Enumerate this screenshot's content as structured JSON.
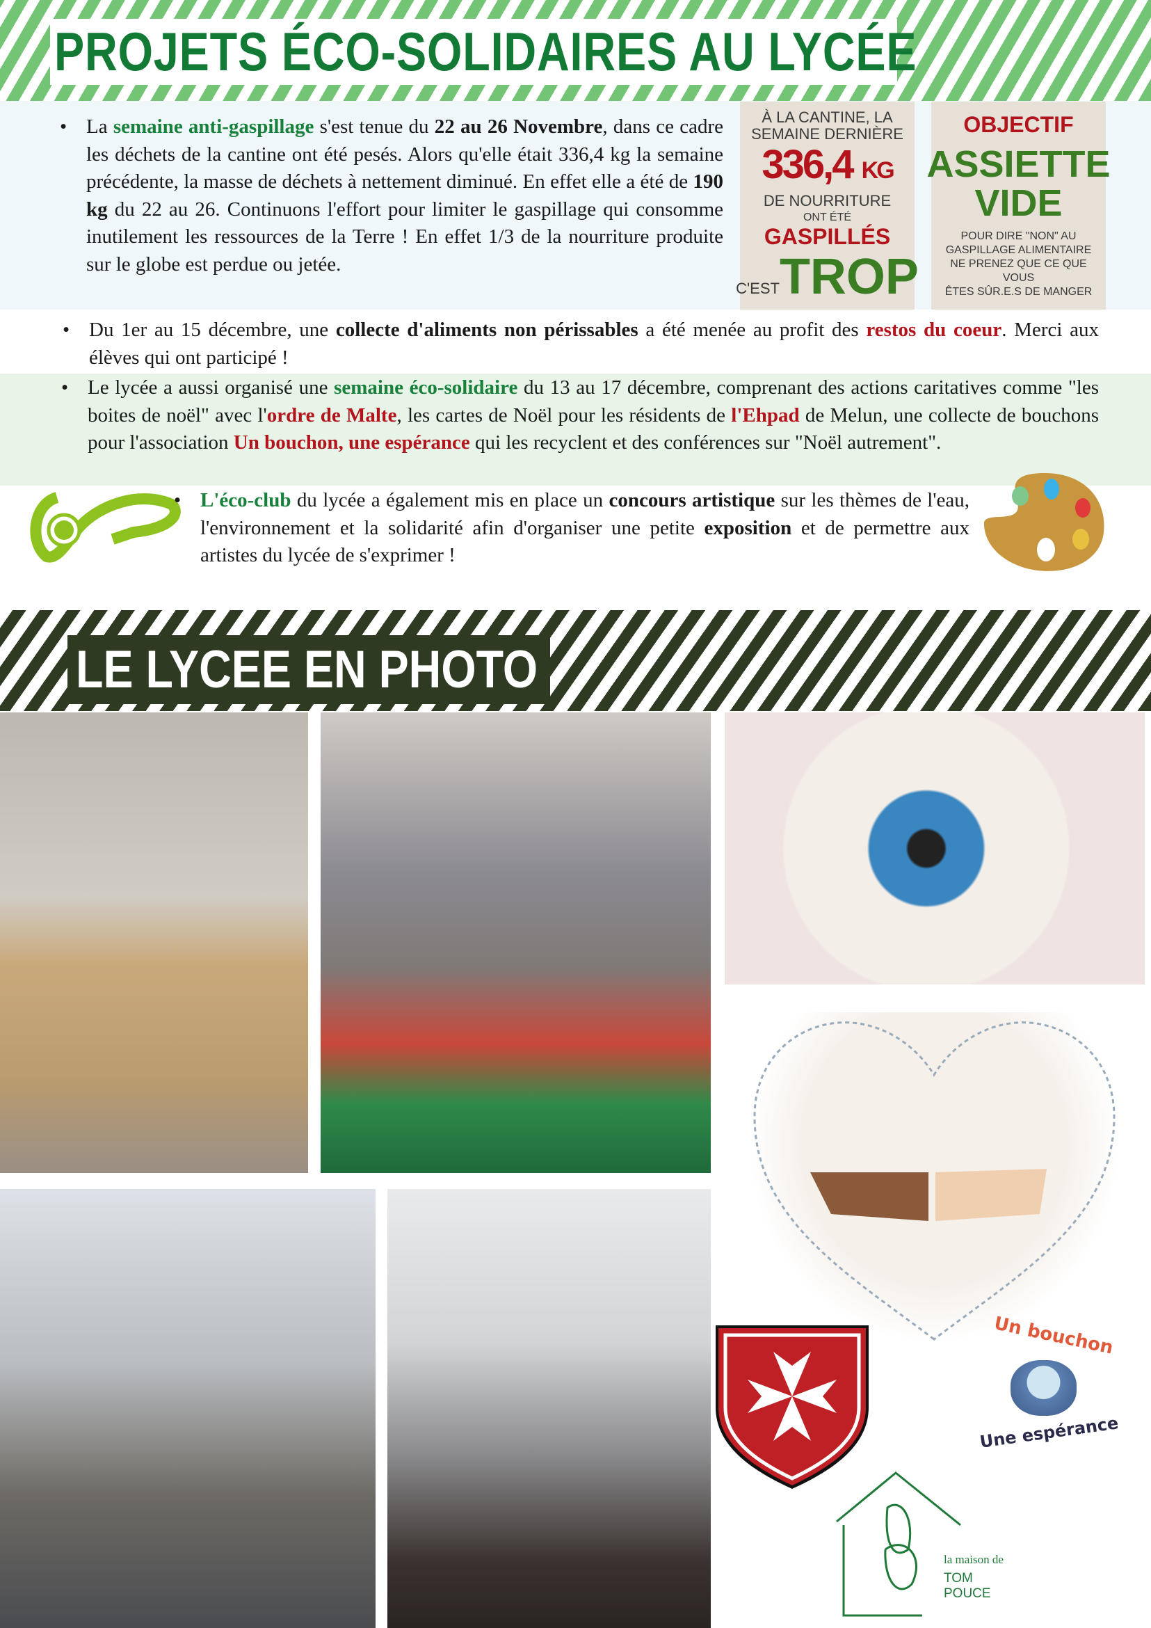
{
  "header": {
    "title": "PROJETS ÉCO-SOLIDAIRES AU LYCÉE"
  },
  "section1": {
    "p1": "La ",
    "h1": "semaine anti-gaspillage",
    "p2": " s'est tenue du ",
    "b1": "22 au 26 Novembre",
    "p3": ", dans ce cadre les déchets de la cantine ont été pesés. Alors qu'elle était 336,4 kg la semaine précédente, la masse de déchets à nettement diminué. En effet elle a été de ",
    "b2": "190 kg",
    "p4": " du 22 au 26. Continuons l'effort pour limiter le gaspillage qui consomme inutilement les ressources de la Terre ! En effet 1/3 de la nourriture produite sur le globe est perdue ou jetée."
  },
  "poster1": {
    "l1": "À LA CANTINE, LA",
    "l2": "SEMAINE DERNIÈRE",
    "big": "336,4",
    "unit": "KG",
    "l3": "DE NOURRITURE",
    "l4": "ONT ÉTÉ",
    "l5": "GASPILLÉS",
    "l6": "C'EST",
    "l7": "TROP"
  },
  "poster2": {
    "l1": "OBJECTIF",
    "l2": "ASSIETTE",
    "l3": "VIDE",
    "l4": "POUR DIRE \"NON\" AU",
    "l5": "GASPILLAGE ALIMENTAIRE",
    "l6": "NE PRENEZ QUE CE QUE VOUS",
    "l7": "ÊTES SÛR.E.S DE MANGER"
  },
  "section2": {
    "p1": "Du 1er au 15 décembre, une ",
    "b1": "collecte d'aliments non périssables",
    "p2": " a été menée au profit des ",
    "r1": "restos du coeur",
    "p3": ". Merci aux élèves qui ont participé !"
  },
  "section3": {
    "p1": "Le lycée a aussi organisé une ",
    "g1": "semaine éco-solidaire",
    "p2": " du 13 au 17 décembre, comprenant des actions caritatives comme \"les boites de noël\" avec l'",
    "r1": "ordre de Malte",
    "p3": ", les cartes de Noël pour les résidents de ",
    "r2": "l'Ehpad",
    "p4": " de Melun, une collecte de bouchons pour l'association ",
    "r3": "Un bouchon, une espérance",
    "p5": " qui les recyclent et des conférences sur \"Noël autrement\"."
  },
  "section4": {
    "g1": "L'éco-club",
    "p1": " du lycée a également mis en place un ",
    "b1": "concours artistique",
    "p2": " sur les thèmes de l'eau, l'environnement et la solidarité afin d'organiser une petite ",
    "b2": "exposition",
    "p3": " et de permettre aux artistes du lycée de s'exprimer !"
  },
  "photos": {
    "title": "LE LYCEE EN PHOTO"
  },
  "logos": {
    "bouchon_top": "Un bouchon",
    "bouchon_bottom": "Une espérance",
    "tompouce_1": "la maison de",
    "tompouce_2": "TOM POUCE"
  },
  "bullet": "•"
}
